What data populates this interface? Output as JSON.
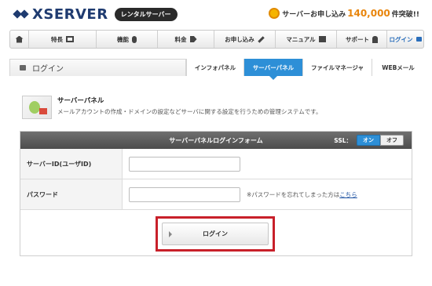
{
  "header": {
    "logo_text": "XSERVER",
    "rental_badge": "レンタルサーバー",
    "promo_prefix": "サーバーお申し込み",
    "promo_count": "140,000",
    "promo_suffix": "件突破!!"
  },
  "nav": {
    "items": [
      {
        "label": "",
        "icon": "home-icon"
      },
      {
        "label": "特長",
        "icon": "monitor-icon"
      },
      {
        "label": "機能",
        "icon": "mouse-icon"
      },
      {
        "label": "料金",
        "icon": "tag-icon"
      },
      {
        "label": "お申し込み",
        "icon": "pen-icon"
      },
      {
        "label": "マニュアル",
        "icon": "book-icon"
      },
      {
        "label": "サポート",
        "icon": "user-icon"
      },
      {
        "label": "ログイン",
        "icon": "lock-icon"
      }
    ]
  },
  "tabbar": {
    "page_label": "ログイン",
    "tabs": [
      {
        "label": "インフォパネル"
      },
      {
        "label": "サーバーパネル",
        "active": true
      },
      {
        "label": "ファイルマネージャ"
      },
      {
        "label": "WEBメール"
      }
    ]
  },
  "intro": {
    "title": "サーバーパネル",
    "description": "メールアカウントの作成・ドメインの設定などサーバに関する設定を行うための管理システムです。"
  },
  "form": {
    "title": "サーバーパネルログインフォーム",
    "ssl_label": "SSL：",
    "ssl_on": "オン",
    "ssl_off": "オフ",
    "ssl_state": "on",
    "server_id_label": "サーバーID(ユーザID)",
    "server_id_value": "",
    "password_label": "パスワード",
    "password_value": "",
    "forgot_prefix": "※パスワードを忘れてしまった方は",
    "forgot_link": "こちら",
    "login_button": "ログイン"
  },
  "colors": {
    "brand": "#1f3b70",
    "accent": "#2d8fd7",
    "promo": "#e8850c",
    "highlight": "#c8202a"
  }
}
